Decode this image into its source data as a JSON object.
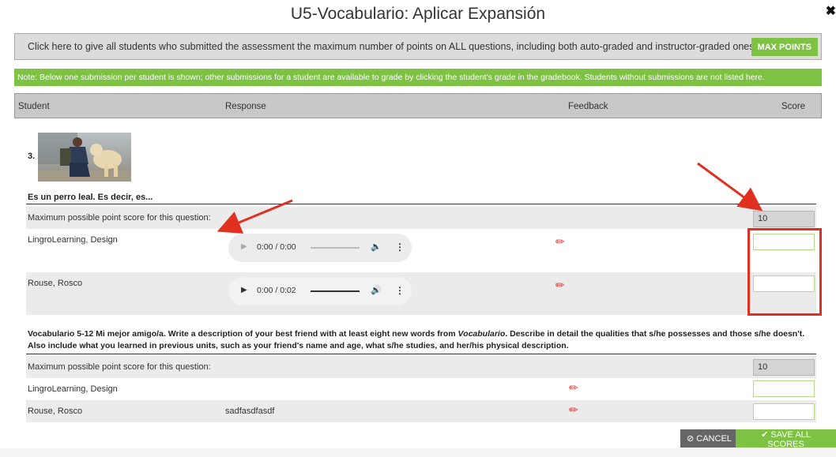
{
  "title": "U5-Vocabulario: Aplicar Expansión",
  "close_icon": "close-icon",
  "max_points_bar": {
    "text": "Click here to give all students who submitted the assessment the maximum number of points on ALL questions, including both auto-graded and instructor-graded ones.",
    "button": "MAX POINTS"
  },
  "note": "Note: Below one submission per student is shown; other submissions for a student are available to grade by clicking the student's grade in the gradebook. Students without submissions are not listed here.",
  "table_headers": {
    "student": "Student",
    "response": "Response",
    "feedback": "Feedback",
    "score": "Score"
  },
  "question1": {
    "number": "3.",
    "text": "Es un perro leal. Es decir, es...",
    "max_label": "Maximum possible point score for this question:",
    "max_score": "10",
    "rows": [
      {
        "student": "LingroLearning, Design",
        "audio_time": "0:00 / 0:00"
      },
      {
        "student": "Rouse, Rosco",
        "audio_time": "0:00 / 0:02"
      }
    ]
  },
  "question2": {
    "text_prefix": "Vocabulario 5-12 Mi mejor amigo/a. Write a description of your best friend with at least eight new words from ",
    "text_italic": "Vocabulario",
    "text_suffix": ". Describe in detail the qualities that s/he possesses and those s/he doesn't. Also include what you learned in previous units, such as your friend's name and age, what s/he studies, and her/his physical description.",
    "max_label": "Maximum possible point score for this question:",
    "max_score": "10",
    "rows": [
      {
        "student": "LingroLearning, Design",
        "response": ""
      },
      {
        "student": "Rouse, Rosco",
        "response": "sadfasdfasdf"
      }
    ]
  },
  "buttons": {
    "cancel": "CANCEL",
    "save": "SAVE ALL SCORES"
  },
  "colors": {
    "accent_green": "#7dc242",
    "annotation_red": "#e03020",
    "header_gray": "#c8c8c8"
  }
}
